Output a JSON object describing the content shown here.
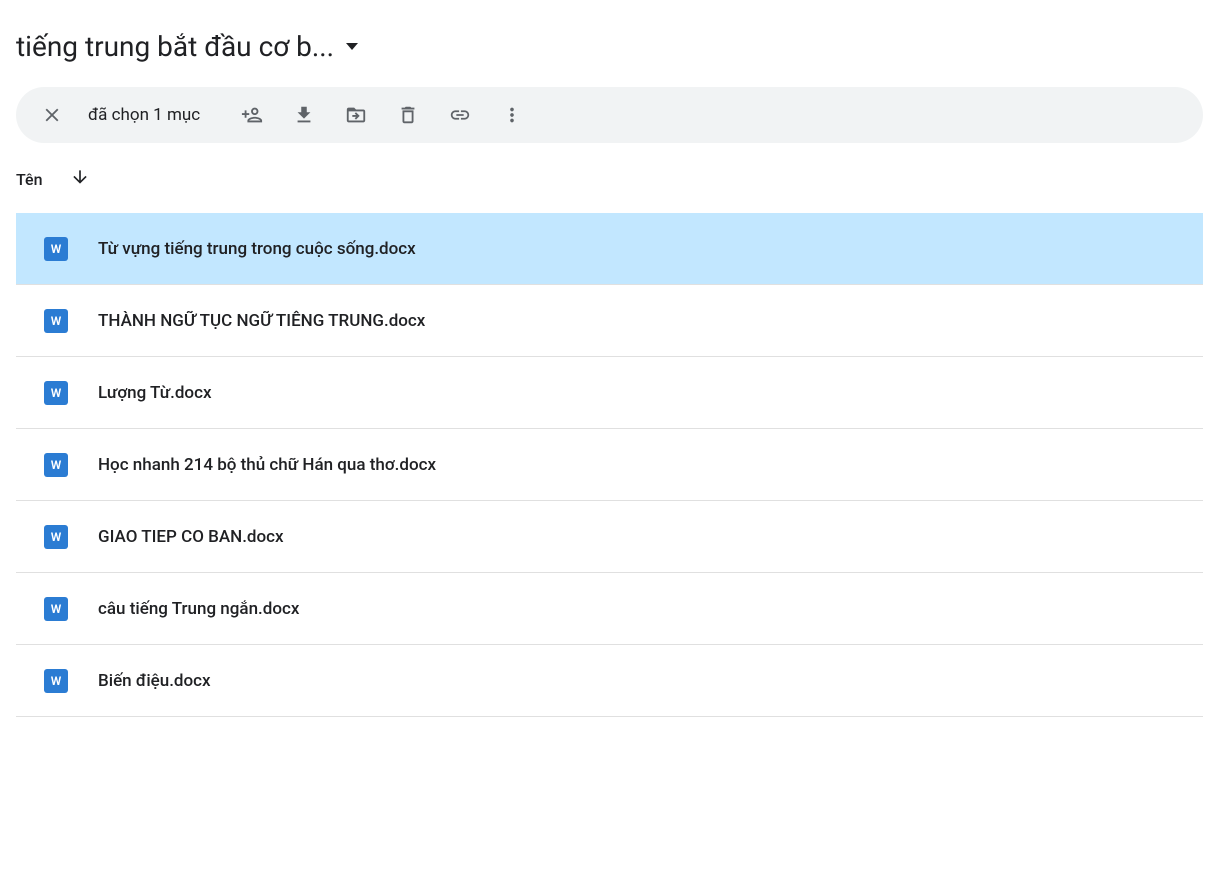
{
  "header": {
    "folder_title": "tiếng trung bắt đầu cơ b..."
  },
  "selection_bar": {
    "selection_text": "đã chọn 1 mục"
  },
  "column_header": {
    "name_label": "Tên"
  },
  "files": [
    {
      "name": "Từ vựng tiếng trung trong cuộc sống.docx",
      "selected": true
    },
    {
      "name": "THÀNH NGỮ TỤC NGỮ TIÊNG TRUNG.docx",
      "selected": false
    },
    {
      "name": "Lượng Từ.docx",
      "selected": false
    },
    {
      "name": "Học nhanh 214 bộ thủ chữ Hán qua thơ.docx",
      "selected": false
    },
    {
      "name": "GIAO TIEP CO BAN.docx",
      "selected": false
    },
    {
      "name": "câu tiếng Trung ngắn.docx",
      "selected": false
    },
    {
      "name": "Biến điệu.docx",
      "selected": false
    }
  ],
  "icons": {
    "word_letter": "W"
  }
}
